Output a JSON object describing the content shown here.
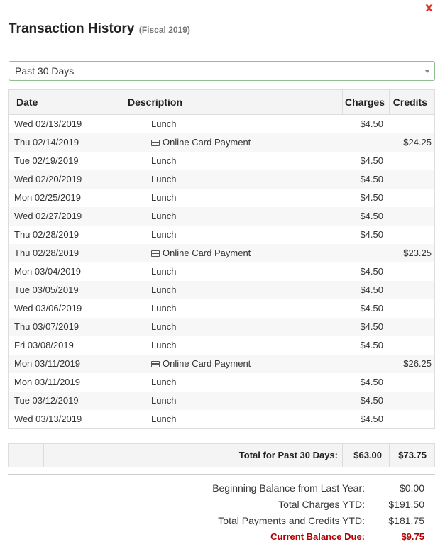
{
  "close_label": "x",
  "title": "Transaction History",
  "subtitle": "(Fiscal 2019)",
  "filter": {
    "selected": "Past 30 Days"
  },
  "table": {
    "headers": {
      "date": "Date",
      "description": "Description",
      "charges": "Charges",
      "credits": "Credits"
    },
    "rows": [
      {
        "date": "Wed 02/13/2019",
        "description": "Lunch",
        "charge": "$4.50",
        "credit": "",
        "icon": ""
      },
      {
        "date": "Thu 02/14/2019",
        "description": "Online Card Payment",
        "charge": "",
        "credit": "$24.25",
        "icon": "credit-card-icon"
      },
      {
        "date": "Tue 02/19/2019",
        "description": "Lunch",
        "charge": "$4.50",
        "credit": "",
        "icon": ""
      },
      {
        "date": "Wed 02/20/2019",
        "description": "Lunch",
        "charge": "$4.50",
        "credit": "",
        "icon": ""
      },
      {
        "date": "Mon 02/25/2019",
        "description": "Lunch",
        "charge": "$4.50",
        "credit": "",
        "icon": ""
      },
      {
        "date": "Wed 02/27/2019",
        "description": "Lunch",
        "charge": "$4.50",
        "credit": "",
        "icon": ""
      },
      {
        "date": "Thu 02/28/2019",
        "description": "Lunch",
        "charge": "$4.50",
        "credit": "",
        "icon": ""
      },
      {
        "date": "Thu 02/28/2019",
        "description": "Online Card Payment",
        "charge": "",
        "credit": "$23.25",
        "icon": "credit-card-icon"
      },
      {
        "date": "Mon 03/04/2019",
        "description": "Lunch",
        "charge": "$4.50",
        "credit": "",
        "icon": ""
      },
      {
        "date": "Tue 03/05/2019",
        "description": "Lunch",
        "charge": "$4.50",
        "credit": "",
        "icon": ""
      },
      {
        "date": "Wed 03/06/2019",
        "description": "Lunch",
        "charge": "$4.50",
        "credit": "",
        "icon": ""
      },
      {
        "date": "Thu 03/07/2019",
        "description": "Lunch",
        "charge": "$4.50",
        "credit": "",
        "icon": ""
      },
      {
        "date": "Fri 03/08/2019",
        "description": "Lunch",
        "charge": "$4.50",
        "credit": "",
        "icon": ""
      },
      {
        "date": "Mon 03/11/2019",
        "description": "Online Card Payment",
        "charge": "",
        "credit": "$26.25",
        "icon": "credit-card-icon"
      },
      {
        "date": "Mon 03/11/2019",
        "description": "Lunch",
        "charge": "$4.50",
        "credit": "",
        "icon": ""
      },
      {
        "date": "Tue 03/12/2019",
        "description": "Lunch",
        "charge": "$4.50",
        "credit": "",
        "icon": ""
      },
      {
        "date": "Wed 03/13/2019",
        "description": "Lunch",
        "charge": "$4.50",
        "credit": "",
        "icon": ""
      }
    ]
  },
  "totals": {
    "label": "Total for Past 30 Days:",
    "charges": "$63.00",
    "credits": "$73.75"
  },
  "summary": [
    {
      "label": "Beginning Balance from Last Year:",
      "value": "$0.00"
    },
    {
      "label": "Total Charges YTD:",
      "value": "$191.50"
    },
    {
      "label": "Total Payments and Credits YTD:",
      "value": "$181.75"
    },
    {
      "label": "Current Balance Due:",
      "value": "$9.75"
    }
  ],
  "colors": {
    "close": "#d9342b",
    "balance_due": "#b30000",
    "select_border": "#8fbf8f"
  }
}
